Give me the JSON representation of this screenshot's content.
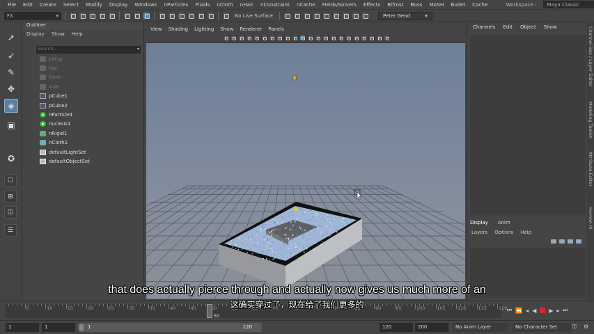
{
  "menubar": {
    "items": [
      "File",
      "Edit",
      "Create",
      "Select",
      "Modify",
      "Display",
      "Windows",
      "nParticles",
      "Fluids",
      "nCloth",
      "nHair",
      "nConstraint",
      "nCache",
      "Fields/Solvers",
      "Effects",
      "Bifrost",
      "Boss",
      "MASH",
      "Bullet",
      "Cache"
    ],
    "workspace_label": "Workspace :",
    "workspace_value": "Maya Classic"
  },
  "statusline": {
    "menuset": "FX",
    "live_surface": "No Live Surface",
    "user": "Peter Gend"
  },
  "outliner": {
    "title": "Outliner",
    "menu": [
      "Display",
      "Show",
      "Help"
    ],
    "search_placeholder": "Search...",
    "items": [
      {
        "label": "persp",
        "icon": "camera-icon",
        "dim": true
      },
      {
        "label": "top",
        "icon": "camera-icon",
        "dim": true
      },
      {
        "label": "front",
        "icon": "camera-icon",
        "dim": true
      },
      {
        "label": "side",
        "icon": "camera-icon",
        "dim": true
      },
      {
        "label": "pCube1",
        "icon": "mesh-icon",
        "dim": false
      },
      {
        "label": "pCube2",
        "icon": "mesh-icon",
        "dim": false
      },
      {
        "label": "nParticle1",
        "icon": "particle-icon",
        "dim": false
      },
      {
        "label": "nucleus1",
        "icon": "nucleus-icon",
        "dim": false
      },
      {
        "label": "nRigid1",
        "icon": "rigid-icon",
        "dim": false
      },
      {
        "label": "nCloth1",
        "icon": "cloth-icon",
        "dim": false
      },
      {
        "label": "defaultLightSet",
        "icon": "set-icon",
        "dim": false
      },
      {
        "label": "defaultObjectSet",
        "icon": "set-icon",
        "dim": false
      }
    ]
  },
  "viewport": {
    "menu": [
      "View",
      "Shading",
      "Lighting",
      "Show",
      "Renderer",
      "Panels"
    ]
  },
  "channelbox": {
    "menu": [
      "Channels",
      "Edit",
      "Object",
      "Show"
    ]
  },
  "layers": {
    "tabs": [
      "Display",
      "Anim"
    ],
    "menu": [
      "Layers",
      "Options",
      "Help"
    ]
  },
  "sidetabs": [
    "Channel Box / Layer Editor",
    "Modeling Toolkit",
    "Attribute Editor",
    "Human IK"
  ],
  "timeslider": {
    "ticks": [
      "5",
      "10",
      "15",
      "20",
      "25",
      "30",
      "35",
      "40",
      "45",
      "50",
      "55",
      "60",
      "65",
      "70",
      "75",
      "80",
      "85",
      "90",
      "95",
      "100",
      "105",
      "110",
      "115",
      "120"
    ],
    "current_frame": "50",
    "current_frame_value": 50,
    "range_start": 1,
    "range_end": 120,
    "frame_field": "1"
  },
  "range": {
    "start_field": "1",
    "inner_start": "1",
    "slider_start": "1",
    "slider_end": "120",
    "end_field": "120",
    "anim_end": "200",
    "anim_layer": "No Anim Layer",
    "char_set": "No Character Set"
  },
  "subtitles": {
    "en": "that does actually pierce through and actually now gives us much more of an",
    "zh": "这确实穿过了，现在给了我们更多的"
  },
  "colors": {
    "accent": "#5b7fa3",
    "maya_logo": "#17b5c0",
    "record": "#dd2233"
  }
}
